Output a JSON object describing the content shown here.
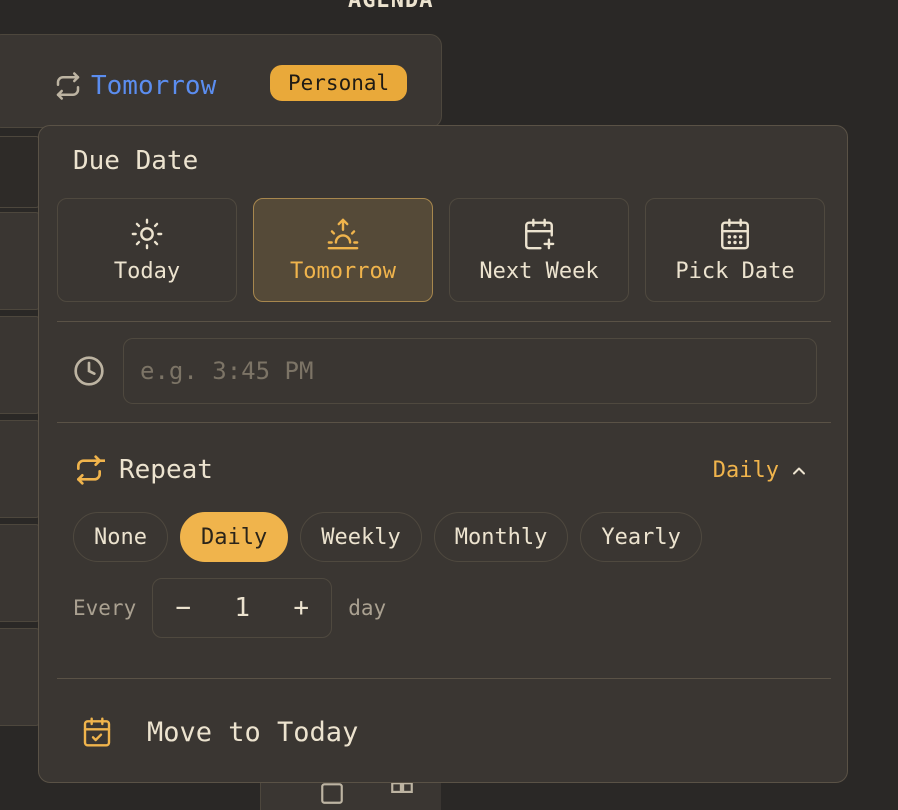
{
  "header": {
    "title": "AGENDA"
  },
  "task_card": {
    "due_label": "Tomorrow",
    "tag": "Personal"
  },
  "popover": {
    "title": "Due Date",
    "date_options": [
      {
        "label": "Today",
        "icon": "sun-icon"
      },
      {
        "label": "Tomorrow",
        "icon": "sunrise-icon",
        "selected": true
      },
      {
        "label": "Next Week",
        "icon": "calendar-plus-icon"
      },
      {
        "label": "Pick Date",
        "icon": "calendar-grid-icon"
      }
    ],
    "time_placeholder": "e.g. 3:45 PM",
    "time_value": "",
    "repeat": {
      "label": "Repeat",
      "current": "Daily",
      "options": [
        "None",
        "Daily",
        "Weekly",
        "Monthly",
        "Yearly"
      ],
      "every_label": "Every",
      "interval": "1",
      "unit": "day",
      "decrement": "−",
      "increment": "+"
    },
    "move_label": "Move to Today"
  },
  "colors": {
    "accent": "#f0b44c",
    "link": "#5b8def",
    "panel": "#3a3632",
    "tag_bg": "#e9a93a"
  }
}
